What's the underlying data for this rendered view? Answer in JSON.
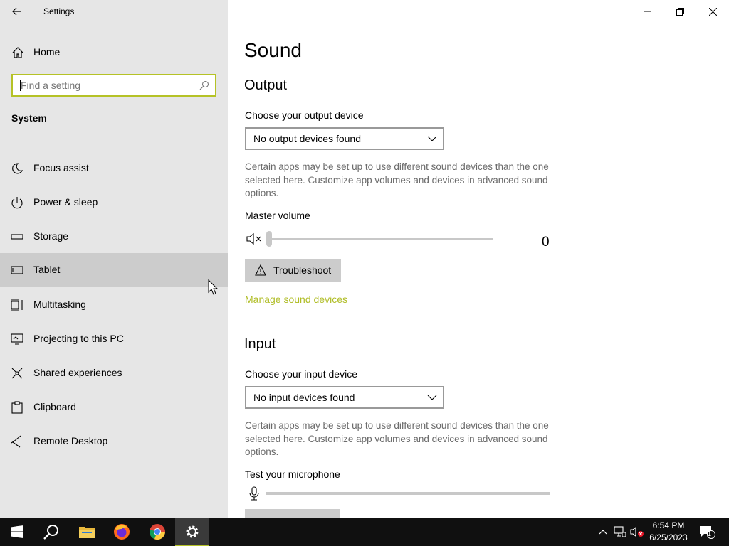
{
  "window": {
    "title": "Settings"
  },
  "sidebar": {
    "home_label": "Home",
    "search_placeholder": "Find a setting",
    "section": "System",
    "items": [
      {
        "label": "Focus assist",
        "icon": "moon-icon"
      },
      {
        "label": "Power & sleep",
        "icon": "power-icon"
      },
      {
        "label": "Storage",
        "icon": "storage-icon"
      },
      {
        "label": "Tablet",
        "icon": "tablet-icon",
        "active": true
      },
      {
        "label": "Multitasking",
        "icon": "multitasking-icon"
      },
      {
        "label": "Projecting to this PC",
        "icon": "projecting-icon"
      },
      {
        "label": "Shared experiences",
        "icon": "shared-experiences-icon"
      },
      {
        "label": "Clipboard",
        "icon": "clipboard-icon"
      },
      {
        "label": "Remote Desktop",
        "icon": "remote-desktop-icon"
      }
    ]
  },
  "main": {
    "title": "Sound",
    "output": {
      "heading": "Output",
      "device_label": "Choose your output device",
      "device_value": "No output devices found",
      "description": "Certain apps may be set up to use different sound devices than the one selected here. Customize app volumes and devices in advanced sound options.",
      "volume_label": "Master volume",
      "volume_value": "0",
      "troubleshoot_label": "Troubleshoot",
      "manage_link": "Manage sound devices"
    },
    "input": {
      "heading": "Input",
      "device_label": "Choose your input device",
      "device_value": "No input devices found",
      "description": "Certain apps may be set up to use different sound devices than the one selected here. Customize app volumes and devices in advanced sound options.",
      "mic_label": "Test your microphone"
    }
  },
  "colors": {
    "accent": "#b5c226",
    "link": "#b0bd26",
    "sidebar_bg": "#e6e6e6",
    "active_item_bg": "#cccccc",
    "taskbar_bg": "#101010"
  },
  "taskbar": {
    "apps": [
      "start-icon",
      "search-icon",
      "file-explorer-icon",
      "firefox-icon",
      "chrome-icon",
      "settings-icon"
    ],
    "time": "6:54 PM",
    "date": "6/25/2023",
    "notification_count": "1"
  }
}
